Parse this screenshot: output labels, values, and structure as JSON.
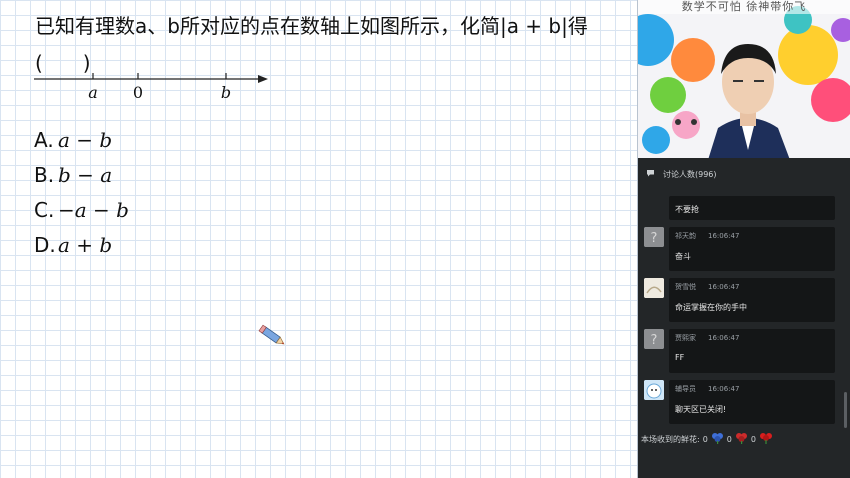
{
  "question": {
    "text": "已知有理数a、b所对应的点在数轴上如图所示，化简|a + b|得",
    "paren": "(　　)"
  },
  "number_line": {
    "labels": [
      "a",
      "0",
      "b"
    ]
  },
  "options": [
    {
      "letter": "A.",
      "expr": "a − b"
    },
    {
      "letter": "B.",
      "expr": "b − a"
    },
    {
      "letter": "C.",
      "expr": "−a − b"
    },
    {
      "letter": "D.",
      "expr": "a + b"
    }
  ],
  "video": {
    "caption": "数学不可怕 徐神带你飞"
  },
  "chat": {
    "header": "讨论人数(996)",
    "messages": [
      {
        "user": "",
        "time": "",
        "text": "不要抢"
      },
      {
        "user": "祁天韵",
        "time": "16:06:47",
        "text": "奋斗"
      },
      {
        "user": "贺雪悦",
        "time": "16:06:47",
        "text": "命运掌握在你的手中"
      },
      {
        "user": "贾熙家",
        "time": "16:06:47",
        "text": "FF"
      },
      {
        "user": "辅导员",
        "time": "16:06:47",
        "text": "聊天区已关闭!"
      }
    ],
    "flowers": {
      "label": "本场收到的鲜花:",
      "counts": [
        "0",
        "0",
        "0"
      ],
      "colors": [
        "#3e6fd8",
        "#cc2b2b",
        "#d81e1e"
      ]
    }
  },
  "colors": {
    "panel_bg": "#232628",
    "grid": "#d9e4f1"
  }
}
